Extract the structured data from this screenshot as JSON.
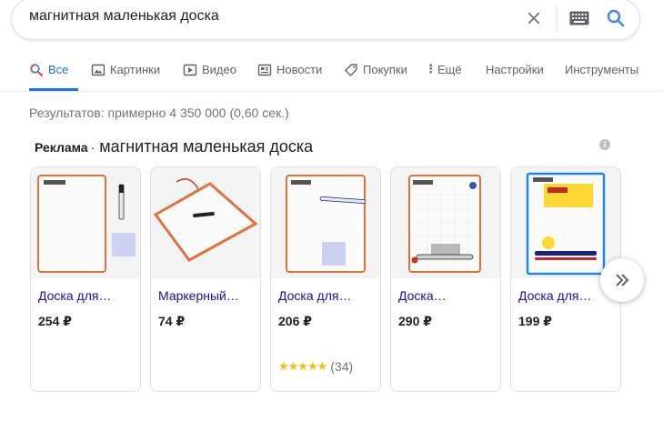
{
  "search": {
    "query": "магнитная маленькая доска"
  },
  "tabs": [
    {
      "label": "Все",
      "icon": "search-icon",
      "active": true
    },
    {
      "label": "Картинки",
      "icon": "image-icon"
    },
    {
      "label": "Видео",
      "icon": "video-icon"
    },
    {
      "label": "Новости",
      "icon": "news-icon"
    },
    {
      "label": "Покупки",
      "icon": "tag-icon"
    },
    {
      "label": "Ещё",
      "icon": "more-dots-icon"
    },
    {
      "label": "Настройки"
    },
    {
      "label": "Инструменты"
    }
  ],
  "results_stats": "Результатов: примерно 4 350 000 (0,60 сек.)",
  "ads": {
    "label": "Реклама",
    "separator": "·",
    "query": "магнитная маленькая доска",
    "products": [
      {
        "title": "Доска для…",
        "price": "254 ₽"
      },
      {
        "title": "Маркерный…",
        "price": "74 ₽"
      },
      {
        "title": "Доска для…",
        "price": "206 ₽",
        "stars": "★★★★★",
        "rating_count": "(34)",
        "rating": 4.5
      },
      {
        "title": "Доска…",
        "price": "290 ₽"
      },
      {
        "title": "Доска для…",
        "price": "199 ₽"
      }
    ]
  },
  "colors": {
    "accent": "#1a73e8",
    "link": "#1a0dab",
    "star": "#fbbc04",
    "muted": "#70757a"
  }
}
